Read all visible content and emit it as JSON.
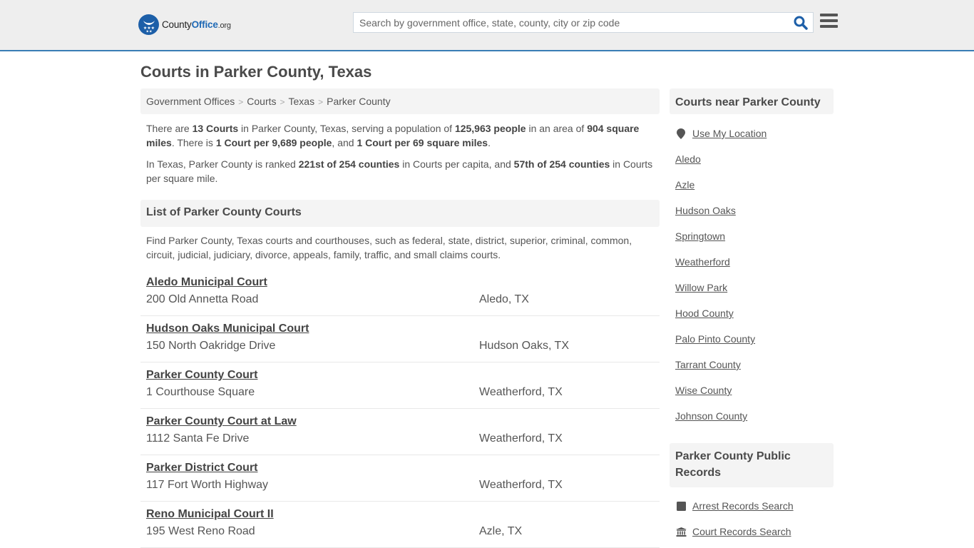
{
  "header": {
    "logo": {
      "word1": "County",
      "word2": "Office",
      "tld": ".org"
    },
    "search": {
      "placeholder": "Search by government office, state, county, city or zip code",
      "value": ""
    },
    "search_icon": "search-icon",
    "menu_icon": "hamburger-menu-icon"
  },
  "page": {
    "title": "Courts in Parker County, Texas",
    "breadcrumb": [
      "Government Offices",
      "Courts",
      "Texas",
      "Parker County"
    ],
    "intro": {
      "p1": {
        "t1": "There are ",
        "b1": "13 Courts",
        "t2": " in Parker County, Texas, serving a population of ",
        "b2": "125,963 people",
        "t3": " in an area of ",
        "b3": "904 square miles",
        "t4": ". There is ",
        "b4": "1 Court per 9,689 people",
        "t5": ", and ",
        "b5": "1 Court per 69 square miles",
        "t6": "."
      },
      "p2": {
        "t1": "In Texas, Parker County is ranked ",
        "b1": "221st of 254 counties",
        "t2": " in Courts per capita, and ",
        "b2": "57th of 254 counties",
        "t3": " in Courts per square mile."
      }
    },
    "list_heading": "List of Parker County Courts",
    "list_description": "Find Parker County, Texas courts and courthouses, such as federal, state, district, superior, criminal, common, circuit, judicial, judiciary, divorce, appeals, family, traffic, and small claims courts.",
    "courts": [
      {
        "name": "Aledo Municipal Court",
        "address": "200 Old Annetta Road",
        "city": "Aledo, TX"
      },
      {
        "name": "Hudson Oaks Municipal Court",
        "address": "150 North Oakridge Drive",
        "city": "Hudson Oaks, TX"
      },
      {
        "name": "Parker County Court",
        "address": "1 Courthouse Square",
        "city": "Weatherford, TX"
      },
      {
        "name": "Parker County Court at Law",
        "address": "1112 Santa Fe Drive",
        "city": "Weatherford, TX"
      },
      {
        "name": "Parker District Court",
        "address": "117 Fort Worth Highway",
        "city": "Weatherford, TX"
      },
      {
        "name": "Reno Municipal Court II",
        "address": "195 West Reno Road",
        "city": "Azle, TX"
      }
    ]
  },
  "sidebar": {
    "nearby_heading": "Courts near Parker County",
    "use_location": "Use My Location",
    "nearby_links": [
      "Aledo",
      "Azle",
      "Hudson Oaks",
      "Springtown",
      "Weatherford",
      "Willow Park",
      "Hood County",
      "Palo Pinto County",
      "Tarrant County",
      "Wise County",
      "Johnson County"
    ],
    "records_heading": "Parker County Public Records",
    "records_links": [
      {
        "label": "Arrest Records Search",
        "icon": "arrest-records-icon"
      },
      {
        "label": "Court Records Search",
        "icon": "courthouse-icon"
      }
    ]
  },
  "colors": {
    "accent": "#1f69b5",
    "header_border": "#3a7db5",
    "header_bg": "#eeeeee",
    "panel_bg": "#f4f4f4",
    "text": "#555555"
  }
}
